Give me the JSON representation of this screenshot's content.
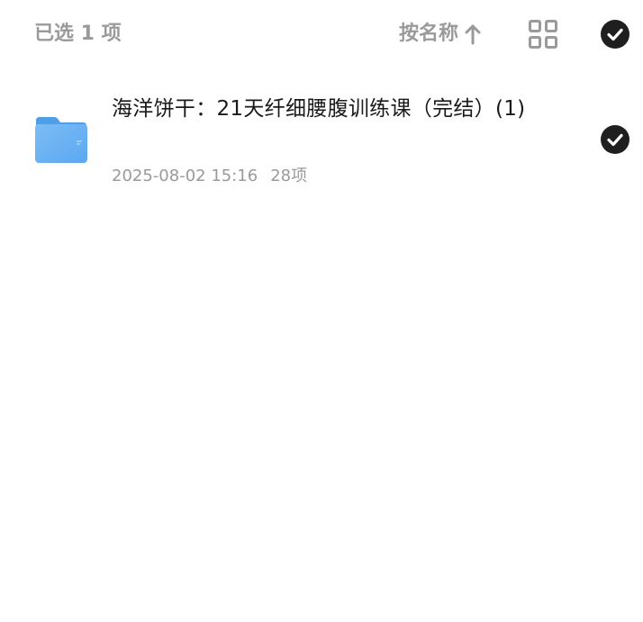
{
  "header": {
    "selection_text": "已选 1 项",
    "sort_label": "按名称",
    "sort_direction_icon": "arrow-up-icon",
    "view_toggle_icon": "grid-view-icon",
    "select_all_icon": "check-circle-icon"
  },
  "files": [
    {
      "icon": "folder-icon",
      "name": "海洋饼干：21天纤细腰腹训练课（完结）(1)",
      "modified": "2025-08-02 15:16",
      "item_count": "28项",
      "selected": true
    }
  ],
  "colors": {
    "muted_text": "#9a9a9a",
    "primary_text": "#1a1a1a",
    "check_bg": "#1f1f1f",
    "folder_blue": "#5aa8f0"
  }
}
